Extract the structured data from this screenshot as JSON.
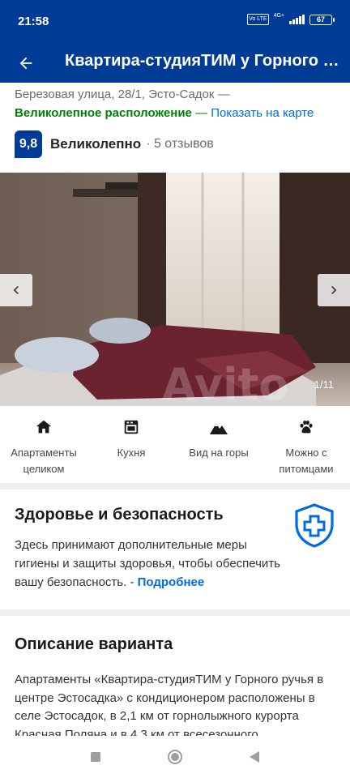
{
  "status_bar": {
    "time": "21:58",
    "network": "4G+",
    "volte": "Vo LTE",
    "battery": "67"
  },
  "app_bar": {
    "title": "Квартира-студияТИМ у Горного ручья в центре Эстосадка"
  },
  "property": {
    "address": "Березовая улица, 28/1, Эсто-Садок —",
    "location_quality": "Великолепное расположение",
    "location_sep": "—",
    "map_link": "Показать на карте",
    "score": "9,8",
    "rating_word": "Великолепно",
    "reviews": "· 5 отзывов"
  },
  "gallery": {
    "counter": "1/11",
    "watermark": "Avito"
  },
  "features": [
    {
      "icon": "home-icon",
      "label": "Апартаменты целиком"
    },
    {
      "icon": "oven-icon",
      "label": "Кухня"
    },
    {
      "icon": "mountain-icon",
      "label": "Вид на горы"
    },
    {
      "icon": "paw-icon",
      "label": "Можно с питомцами"
    }
  ],
  "health": {
    "title": "Здоровье и безопасность",
    "text": "Здесь принимают дополнительные меры гигиены и защиты здоровья, чтобы обеспечить вашу безопасность. -",
    "more_link": "Подробнее"
  },
  "description": {
    "title": "Описание варианта",
    "text": "Апартаменты «Квартира-студияТИМ у Горного ручья в центре Эстосадка» с кондиционером расположены в селе Эстосадок, в 2,1 км от горнолыжного курорта Красная Поляна и в 4,3 км от всесезонного"
  },
  "colors": {
    "brand": "#003b95",
    "link": "#006ce4",
    "positive": "#008009"
  }
}
